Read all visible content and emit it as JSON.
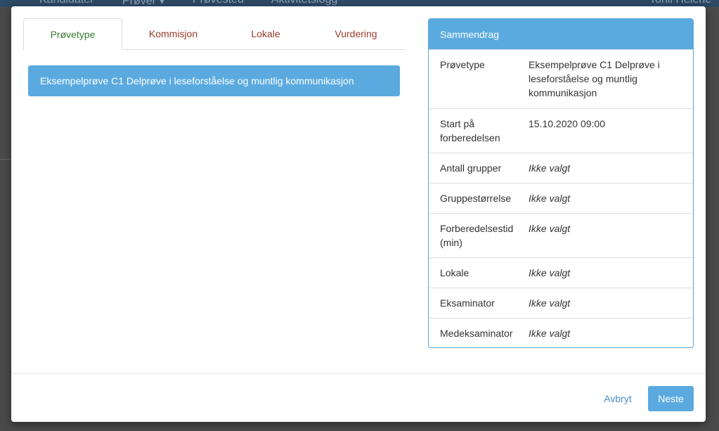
{
  "background": {
    "nav_items": [
      "Kandidater",
      "Prøver ▾",
      "Prøvested",
      "Aktivitetslogg"
    ],
    "user_name": "Torill Helene"
  },
  "tabs": [
    {
      "label": "Prøvetype",
      "active": true
    },
    {
      "label": "Kommisjon",
      "active": false
    },
    {
      "label": "Lokale",
      "active": false
    },
    {
      "label": "Vurdering",
      "active": false
    }
  ],
  "selected_test": "Eksempelprøve C1 Delprøve i leseforståelse og muntlig kommunikasjon",
  "summary": {
    "title": "Sammendrag",
    "rows": [
      {
        "label": "Prøvetype",
        "value": "Eksempelprøve C1 Delprøve i leseforståelse og muntlig kommunikasjon"
      },
      {
        "label": "Start på forberedelsen",
        "value": "15.10.2020 09:00"
      },
      {
        "label": "Antall grupper",
        "value": "Ikke valgt"
      },
      {
        "label": "Gruppestørrelse",
        "value": "Ikke valgt"
      },
      {
        "label": "Forberedelsestid (min)",
        "value": "Ikke valgt"
      },
      {
        "label": "Lokale",
        "value": "Ikke valgt"
      },
      {
        "label": "Eksaminator",
        "value": "Ikke valgt"
      },
      {
        "label": "Medeksaminator",
        "value": "Ikke valgt"
      }
    ]
  },
  "footer": {
    "cancel_label": "Avbryt",
    "next_label": "Neste"
  },
  "colors": {
    "accent": "#5aaadf",
    "active_tab": "#3a7a33",
    "inactive_tab": "#9b3a2c"
  }
}
